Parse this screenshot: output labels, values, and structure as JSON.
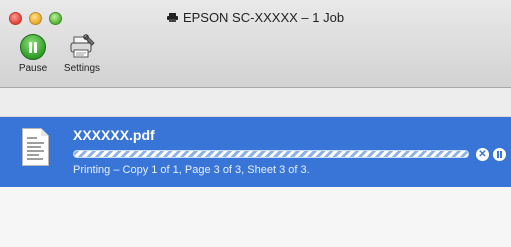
{
  "window": {
    "title": "EPSON SC-XXXXX – 1 Job",
    "title_icon": "printer-icon"
  },
  "toolbar": {
    "pause_label": "Pause",
    "pause_icon": "pause-icon",
    "settings_label": "Settings",
    "settings_icon": "printer-settings-icon"
  },
  "job": {
    "name": "XXXXXX.pdf",
    "status": "Printing – Copy 1 of 1, Page 3 of 3, Sheet 3 of 3.",
    "doc_icon": "document-icon",
    "stop_icon": "stop-icon",
    "hold_icon": "hold-icon"
  },
  "colors": {
    "selection": "#3875d7",
    "pause_green": "#2f9b26"
  }
}
